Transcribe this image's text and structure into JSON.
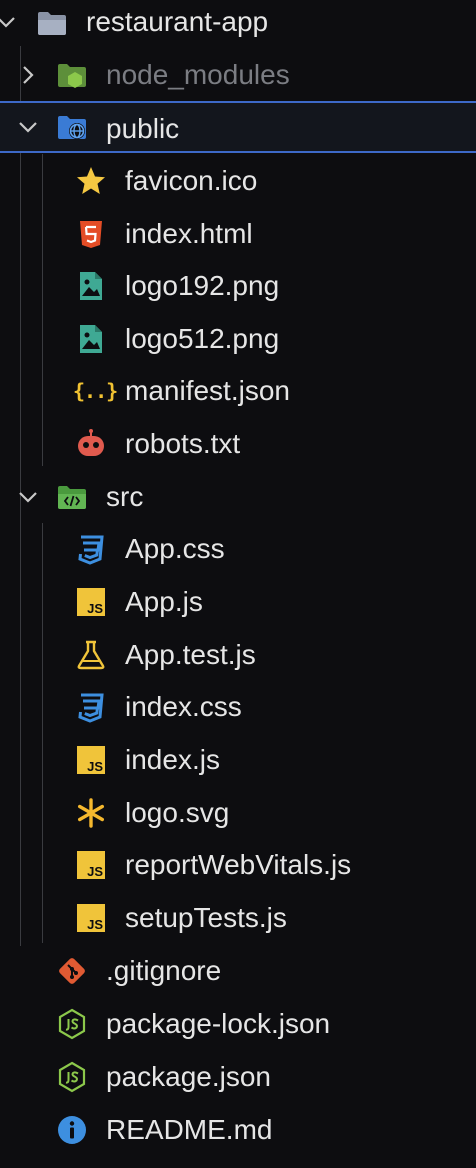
{
  "root": {
    "label": "restaurant-app",
    "expanded": true
  },
  "items": [
    {
      "label": "node_modules",
      "type": "folder",
      "expanded": false,
      "dimmed": true
    },
    {
      "label": "public",
      "type": "folder",
      "expanded": true,
      "selected": true,
      "children": [
        {
          "label": "favicon.ico",
          "icon": "star-icon"
        },
        {
          "label": "index.html",
          "icon": "html5-icon"
        },
        {
          "label": "logo192.png",
          "icon": "image-file-icon"
        },
        {
          "label": "logo512.png",
          "icon": "image-file-icon"
        },
        {
          "label": "manifest.json",
          "icon": "json-braces-icon"
        },
        {
          "label": "robots.txt",
          "icon": "robot-icon"
        }
      ]
    },
    {
      "label": "src",
      "type": "folder",
      "expanded": true,
      "children": [
        {
          "label": "App.css",
          "icon": "css3-icon"
        },
        {
          "label": "App.js",
          "icon": "js-file-icon"
        },
        {
          "label": "App.test.js",
          "icon": "test-flask-icon"
        },
        {
          "label": "index.css",
          "icon": "css3-icon"
        },
        {
          "label": "index.js",
          "icon": "js-file-icon"
        },
        {
          "label": "logo.svg",
          "icon": "svg-asterisk-icon"
        },
        {
          "label": "reportWebVitals.js",
          "icon": "js-file-icon"
        },
        {
          "label": "setupTests.js",
          "icon": "js-file-icon"
        }
      ]
    },
    {
      "label": ".gitignore",
      "icon": "git-icon"
    },
    {
      "label": "package-lock.json",
      "icon": "nodejs-icon"
    },
    {
      "label": "package.json",
      "icon": "nodejs-icon"
    },
    {
      "label": "README.md",
      "icon": "info-icon"
    }
  ],
  "icon_glyphs": {
    "js": "JS",
    "json": "{..}",
    "js_short": "JS"
  },
  "colors": {
    "background": "#0d0d10",
    "selection_border": "#3d69c8",
    "text": "#e6e6e6",
    "dim_text": "#7b7d83",
    "folder": "#8a93a6",
    "star": "#f5c842",
    "html": "#e44d26",
    "image": "#3fa994",
    "json": "#f1c232",
    "robot": "#e05a4e",
    "css": "#3d8fe0",
    "js": "#f0c43a",
    "git": "#e05a33",
    "node": "#8cc84b",
    "info": "#3d8fe0"
  }
}
